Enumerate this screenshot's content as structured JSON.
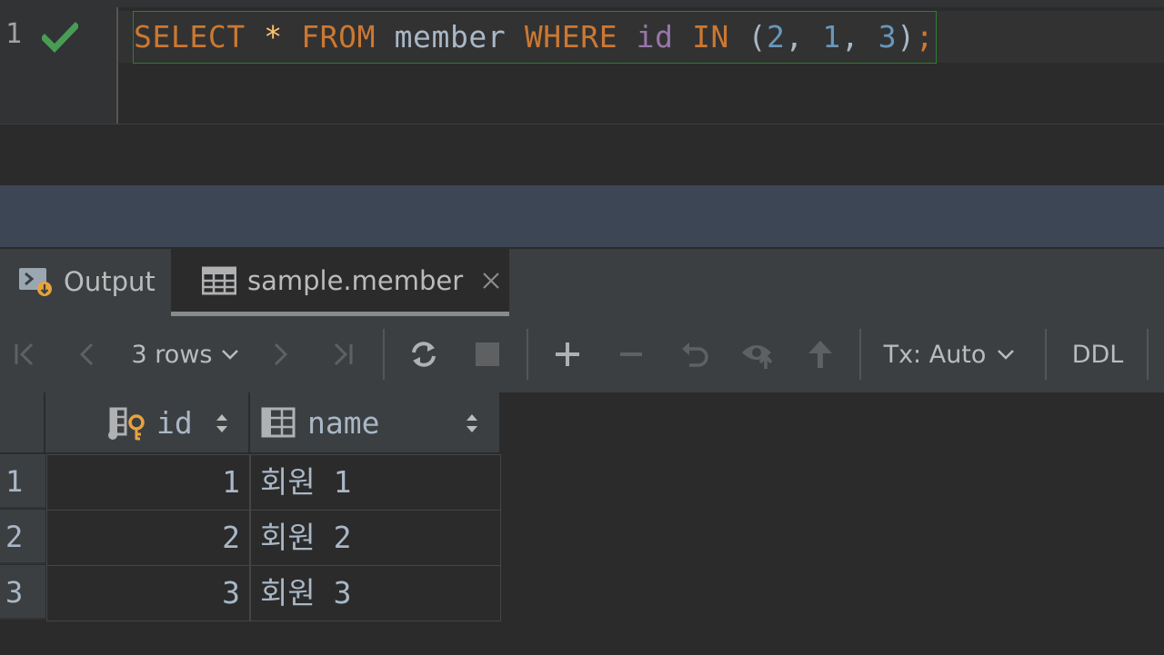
{
  "editor": {
    "line_number": "1",
    "sql": {
      "select": "SELECT",
      "star": "*",
      "from": "FROM",
      "table": "member",
      "where": "WHERE",
      "column": "id",
      "in": "IN",
      "open": "(",
      "n1": "2",
      "c1": ",",
      "n2": "1",
      "c2": ",",
      "n3": "3",
      "close": ")",
      "semi": ";"
    },
    "status_icon": "check-icon"
  },
  "tabs": [
    {
      "label": "Output",
      "icon": "console-output-icon"
    },
    {
      "label": "sample.member",
      "icon": "table-icon",
      "active": true
    }
  ],
  "toolbar": {
    "rows_label": "3 rows",
    "tx_label": "Tx: Auto",
    "ddl_label": "DDL"
  },
  "grid": {
    "columns": [
      {
        "label": "id",
        "icon": "primary-key-column-icon"
      },
      {
        "label": "name",
        "icon": "column-icon"
      }
    ],
    "rows": [
      {
        "num": "1",
        "id": "1",
        "name": "회원 1"
      },
      {
        "num": "2",
        "id": "2",
        "name": "회원 2"
      },
      {
        "num": "3",
        "id": "3",
        "name": "회원 3"
      }
    ]
  },
  "colors": {
    "keyword": "#cc7832",
    "number": "#6897bb",
    "column": "#9876aa",
    "text": "#a9b7c6",
    "success": "#499c54"
  }
}
